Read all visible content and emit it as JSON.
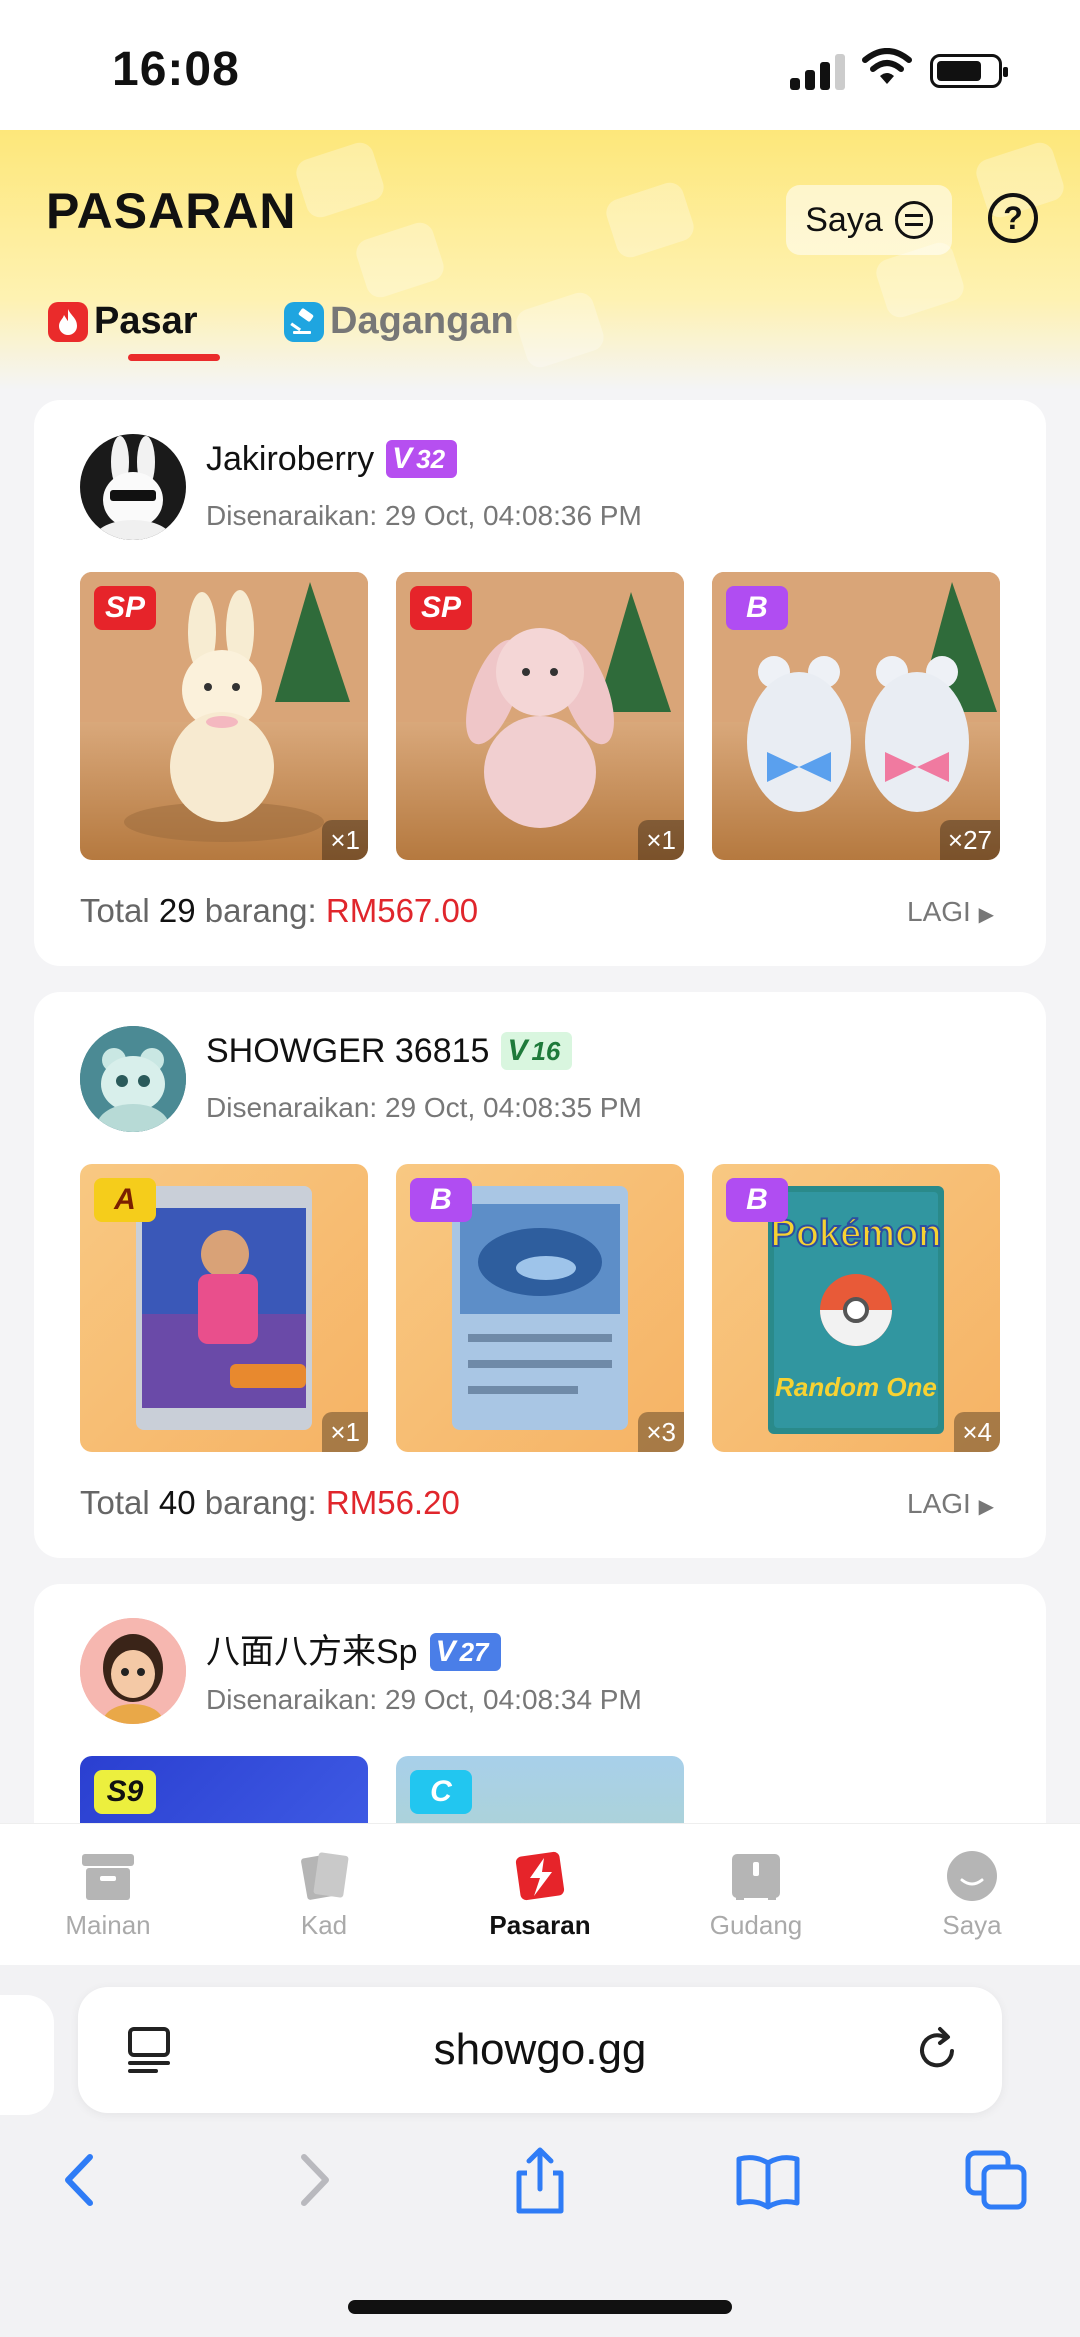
{
  "status_bar": {
    "time": "16:08"
  },
  "header": {
    "title": "PASARAN",
    "saya_label": "Saya",
    "help_glyph": "?",
    "tabs": [
      {
        "label": "Pasar",
        "icon": "fire-icon",
        "active": true
      },
      {
        "label": "Dagangan",
        "icon": "gavel-icon",
        "active": false
      }
    ]
  },
  "listings": [
    {
      "seller": "Jakiroberry",
      "vip_level": "32",
      "listed": "Disenaraikan: 29 Oct, 04:08:36 PM",
      "items": [
        {
          "rarity": "SP",
          "qty": "×1",
          "desc": "cream plush bunny"
        },
        {
          "rarity": "SP",
          "qty": "×1",
          "desc": "pink floral plush bunny"
        },
        {
          "rarity": "B",
          "qty": "×27",
          "desc": "translucent bear figures"
        }
      ],
      "total_prefix": "Total",
      "total_count": "29",
      "total_mid": "barang:",
      "total_price": "RM567.00",
      "more": "LAGI"
    },
    {
      "seller": "SHOWGER 36815",
      "vip_level": "16",
      "listed": "Disenaraikan: 29 Oct, 04:08:35 PM",
      "items": [
        {
          "rarity": "A",
          "qty": "×1",
          "desc": "trainer card"
        },
        {
          "rarity": "B",
          "qty": "×3",
          "desc": "ex pokemon card"
        },
        {
          "rarity": "B",
          "qty": "×4",
          "desc": "Pokemon Random One pack",
          "card_title": "Pokémon",
          "card_sub": "Random One"
        }
      ],
      "total_prefix": "Total",
      "total_count": "40",
      "total_mid": "barang:",
      "total_price": "RM56.20",
      "more": "LAGI"
    },
    {
      "seller": "八面八方来Sp",
      "vip_level": "27",
      "listed": "Disenaraikan: 29 Oct, 04:08:34 PM",
      "items": [
        {
          "rarity": "S9"
        },
        {
          "rarity": "C"
        }
      ]
    }
  ],
  "bottom_nav": [
    {
      "label": "Mainan",
      "icon": "toy-box-icon"
    },
    {
      "label": "Kad",
      "icon": "cards-icon"
    },
    {
      "label": "Pasaran",
      "icon": "market-icon",
      "active": true
    },
    {
      "label": "Gudang",
      "icon": "warehouse-icon"
    },
    {
      "label": "Saya",
      "icon": "profile-icon"
    }
  ],
  "browser": {
    "url": "showgo.gg"
  },
  "colors": {
    "accent_red": "#e0262c",
    "header_yellow": "#fde77a",
    "rarity_sp": "#e6242a",
    "rarity_b": "#b04df2"
  }
}
